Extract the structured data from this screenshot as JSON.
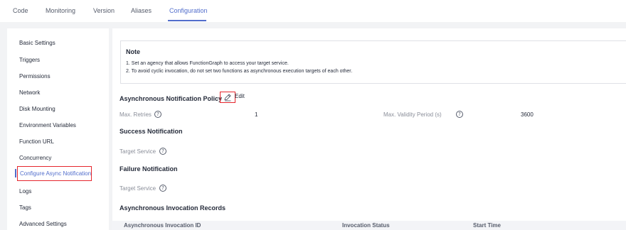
{
  "tabs": [
    {
      "label": "Code"
    },
    {
      "label": "Monitoring"
    },
    {
      "label": "Version"
    },
    {
      "label": "Aliases"
    },
    {
      "label": "Configuration",
      "active": true
    }
  ],
  "sidebar": {
    "items": [
      {
        "label": "Basic Settings"
      },
      {
        "label": "Triggers"
      },
      {
        "label": "Permissions"
      },
      {
        "label": "Network"
      },
      {
        "label": "Disk Mounting"
      },
      {
        "label": "Environment Variables"
      },
      {
        "label": "Function URL"
      },
      {
        "label": "Concurrency"
      },
      {
        "label": "Configure Async Notification",
        "active": true
      },
      {
        "label": "Logs"
      },
      {
        "label": "Tags"
      },
      {
        "label": "Advanced Settings"
      }
    ]
  },
  "note": {
    "title": "Note",
    "line1": "1. Set an agency that allows FunctionGraph to access your target service.",
    "line2": "2. To avoid cyclic invocation, do not set two functions as asynchronous execution targets of each other."
  },
  "policy": {
    "title": "Asynchronous Notification Policy",
    "edit_label": "Edit",
    "max_retries_label": "Max. Retries",
    "max_retries_value": "1",
    "max_validity_label": "Max. Validity Period (s)",
    "max_validity_value": "3600"
  },
  "success": {
    "title": "Success Notification",
    "target_label": "Target Service"
  },
  "failure": {
    "title": "Failure Notification",
    "target_label": "Target Service"
  },
  "records": {
    "title": "Asynchronous Invocation Records",
    "columns": [
      "Asynchronous Invocation ID",
      "Invocation Status",
      "Start Time"
    ]
  },
  "colors": {
    "accent": "#526ecc",
    "highlight_box": "#e5262d",
    "background": "#f2f3f5"
  }
}
